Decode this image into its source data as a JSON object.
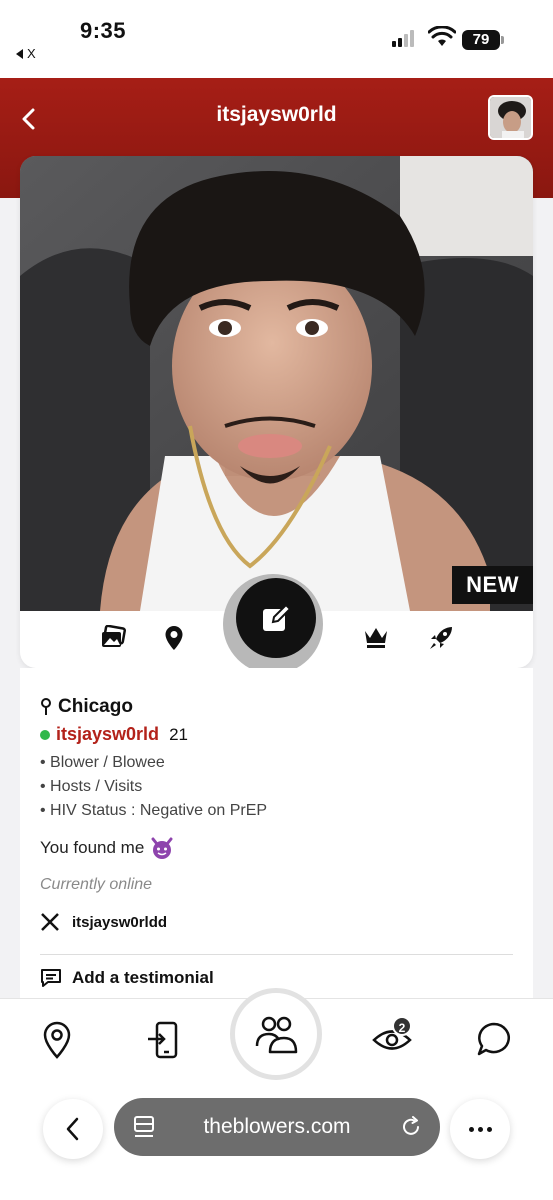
{
  "status_bar": {
    "time": "9:35",
    "back_app": "X",
    "battery": "79"
  },
  "header": {
    "title": "itsjaysw0rld"
  },
  "card": {
    "badge": "NEW"
  },
  "profile": {
    "city": "Chicago",
    "username": "itsjaysw0rld",
    "age": "21",
    "details": [
      "• Blower / Blowee",
      "• Hosts / Visits",
      "• HIV Status : Negative on PrEP"
    ],
    "bio": "You found me",
    "online_status": "Currently online",
    "x_handle": "itsjaysw0rldd",
    "testimonial_label": "Add a testimonial"
  },
  "bottom_nav": {
    "views_badge": "2"
  },
  "browser": {
    "url": "theblowers.com"
  },
  "colors": {
    "header_red": "#a61e16",
    "username_red": "#b3221a",
    "online_green": "#2fb84a"
  }
}
